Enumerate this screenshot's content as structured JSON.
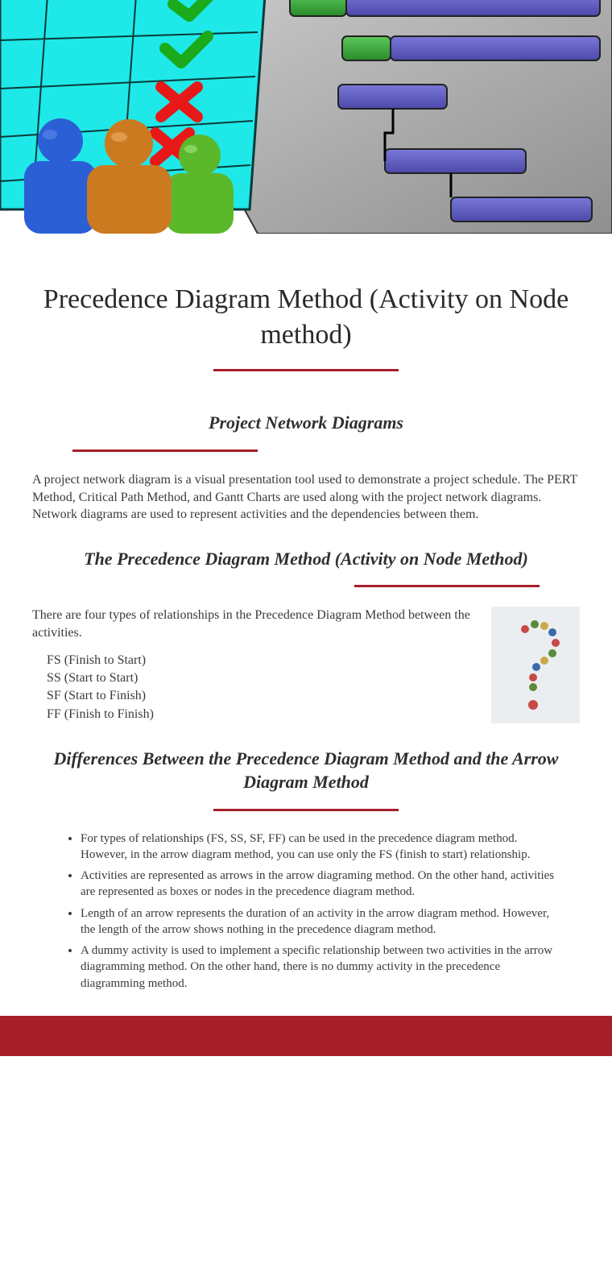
{
  "title": "Precedence Diagram Method (Activity on Node method)",
  "section1": {
    "heading": "Project Network Diagrams",
    "body": "A project network diagram is a visual presentation tool used to demonstrate a project schedule. The PERT Method, Critical Path Method, and Gantt Charts are used along with the project network diagrams. Network diagrams are used to represent activities and the dependencies between them."
  },
  "section2": {
    "heading": "The Precedence Diagram Method (Activity on Node Method)",
    "intro": "There are four types of relationships in the Precedence Diagram Method between the activities.",
    "types": [
      "FS (Finish to Start)",
      "SS (Start to Start)",
      "SF (Start to Finish)",
      "FF (Finish to Finish)"
    ]
  },
  "section3": {
    "heading": "Differences Between the Precedence Diagram Method and the Arrow Diagram Method",
    "bullets": [
      "For types of relationships (FS, SS, SF, FF) can be used in the precedence diagram method. However, in the arrow diagram method, you can use only the FS (finish to start) relationship.",
      "Activities are represented as arrows in the arrow diagraming method. On the other hand, activities are represented as boxes or nodes in the precedence diagram method.",
      "Length of an arrow represents the duration of an activity in the arrow diagram method. However, the length of the arrow shows nothing in the precedence diagram method.",
      "A dummy activity is used to implement a specific relationship between two activities in the arrow diagramming method. On the other hand, there is no dummy activity in the precedence diagramming method."
    ]
  }
}
